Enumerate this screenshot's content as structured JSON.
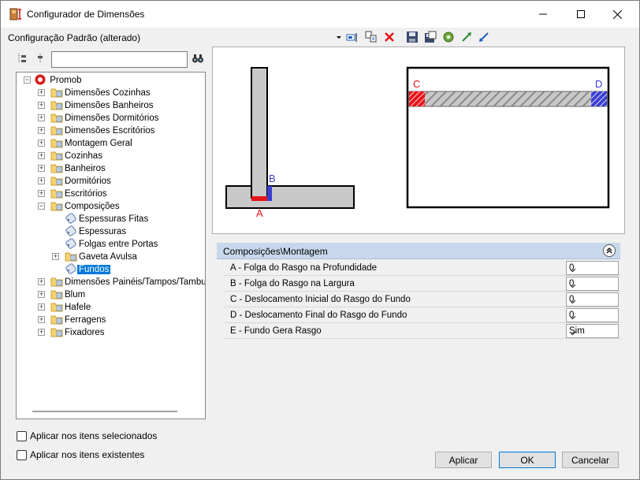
{
  "window": {
    "title": "Configurador de Dimensões",
    "minimize_icon": "minimize-icon",
    "maximize_icon": "maximize-icon",
    "close_icon": "close-icon"
  },
  "config": {
    "name": "Configuração Padrão (alterado)",
    "toolbar_icons": [
      "dropdown-arrow-icon",
      "rename-icon",
      "copy-icon",
      "delete-icon",
      "save-icon",
      "save-as-icon",
      "settings-icon",
      "export-icon",
      "import-icon"
    ]
  },
  "tree": {
    "search_value": "",
    "root": "Promob",
    "items": [
      {
        "label": "Dimensões Cozinhas"
      },
      {
        "label": "Dimensões Banheiros"
      },
      {
        "label": "Dimensões Dormitórios"
      },
      {
        "label": "Dimensões Escritórios"
      },
      {
        "label": "Montagem Geral"
      },
      {
        "label": "Cozinhas"
      },
      {
        "label": "Banheiros"
      },
      {
        "label": "Dormitórios"
      },
      {
        "label": "Escritórios"
      },
      {
        "label": "Composições"
      },
      {
        "label": "Espessuras Fitas"
      },
      {
        "label": "Espessuras"
      },
      {
        "label": "Folgas entre Portas"
      },
      {
        "label": "Gaveta Avulsa"
      },
      {
        "label": "Fundos"
      },
      {
        "label": "Dimensões Painéis/Tampos/Tamburas"
      },
      {
        "label": "Blum"
      },
      {
        "label": "Hafele"
      },
      {
        "label": "Ferragens"
      },
      {
        "label": "Fixadores"
      }
    ]
  },
  "options": {
    "apply_selected": "Aplicar nos itens selecionados",
    "apply_existing": "Aplicar nos itens existentes"
  },
  "preview": {
    "label_a": "A",
    "label_b": "B",
    "label_c": "C",
    "label_d": "D",
    "color_a": "#e8141b",
    "color_b": "#3a3fd0"
  },
  "properties": {
    "category": "Composições\\Montagem",
    "rows": [
      {
        "name": "A - Folga do Rasgo na Profundidade",
        "value": "0"
      },
      {
        "name": "B - Folga do Rasgo na Largura",
        "value": "0"
      },
      {
        "name": "C - Deslocamento Inicial do Rasgo do Fundo",
        "value": "0"
      },
      {
        "name": "D - Deslocamento Final do Rasgo do Fundo",
        "value": "0"
      },
      {
        "name": "E - Fundo Gera Rasgo",
        "value": "Sim"
      }
    ]
  },
  "buttons": {
    "apply": "Aplicar",
    "ok": "OK",
    "cancel": "Cancelar"
  }
}
